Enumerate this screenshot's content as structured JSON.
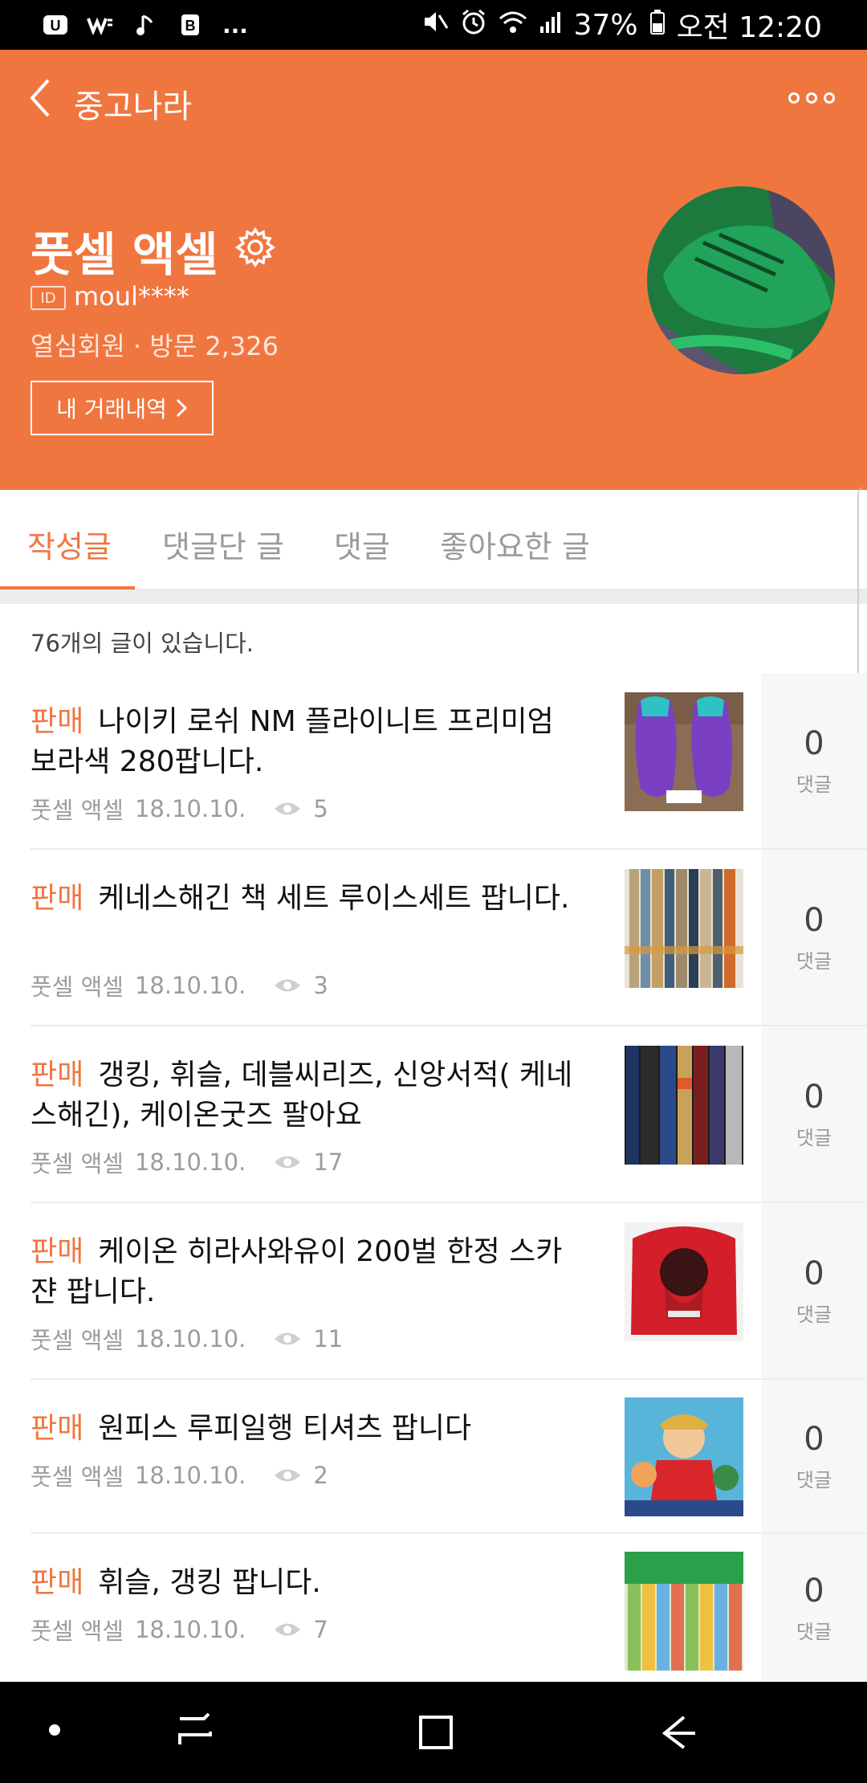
{
  "status_bar": {
    "left_icons": [
      "carrier-icon",
      "network-icon",
      "music-icon",
      "b-icon",
      "more-dots"
    ],
    "more": "...",
    "battery": "37%",
    "time": "오전 12:20"
  },
  "header": {
    "title": "중고나라",
    "profile_name": "풋셀 액셀",
    "id_badge": "ID",
    "id_value": "moul****",
    "member_info": "열심회원 · 방문 2,326",
    "history_button": "내 거래내역",
    "accent_color": "#f07640"
  },
  "tabs": [
    {
      "label": "작성글",
      "active": true
    },
    {
      "label": "댓글단 글",
      "active": false
    },
    {
      "label": "댓글",
      "active": false
    },
    {
      "label": "좋아요한 글",
      "active": false
    }
  ],
  "post_count": "76개의 글이 있습니다.",
  "posts": [
    {
      "category": "판매",
      "title": "나이키 로쉬 NM 플라이니트 프리미엄 보라색 280팝니다.",
      "author": "풋셀 액셀",
      "date": "18.10.10.",
      "views": "5",
      "comments": "0",
      "comment_label": "댓글"
    },
    {
      "category": "판매",
      "title": "케네스해긴 책 세트 루이스세트 팝니다.",
      "author": "풋셀 액셀",
      "date": "18.10.10.",
      "views": "3",
      "comments": "0",
      "comment_label": "댓글"
    },
    {
      "category": "판매",
      "title": "갱킹, 휘슬, 데블씨리즈, 신앙서적( 케네스해긴), 케이온굿즈 팔아요",
      "author": "풋셀 액셀",
      "date": "18.10.10.",
      "views": "17",
      "comments": "0",
      "comment_label": "댓글"
    },
    {
      "category": "판매",
      "title": "케이온 히라사와유이 200벌 한정 스카쟌 팝니다.",
      "author": "풋셀 액셀",
      "date": "18.10.10.",
      "views": "11",
      "comments": "0",
      "comment_label": "댓글"
    },
    {
      "category": "판매",
      "title": "원피스 루피일행 티셔츠 팝니다",
      "author": "풋셀 액셀",
      "date": "18.10.10.",
      "views": "2",
      "comments": "0",
      "comment_label": "댓글"
    },
    {
      "category": "판매",
      "title": "휘슬, 갱킹 팝니다.",
      "author": "풋셀 액셀",
      "date": "18.10.10.",
      "views": "7",
      "comments": "0",
      "comment_label": "댓글"
    }
  ],
  "nav_bar": {
    "items": [
      "dot-icon",
      "recent-apps-icon",
      "home-icon",
      "back-icon"
    ]
  }
}
